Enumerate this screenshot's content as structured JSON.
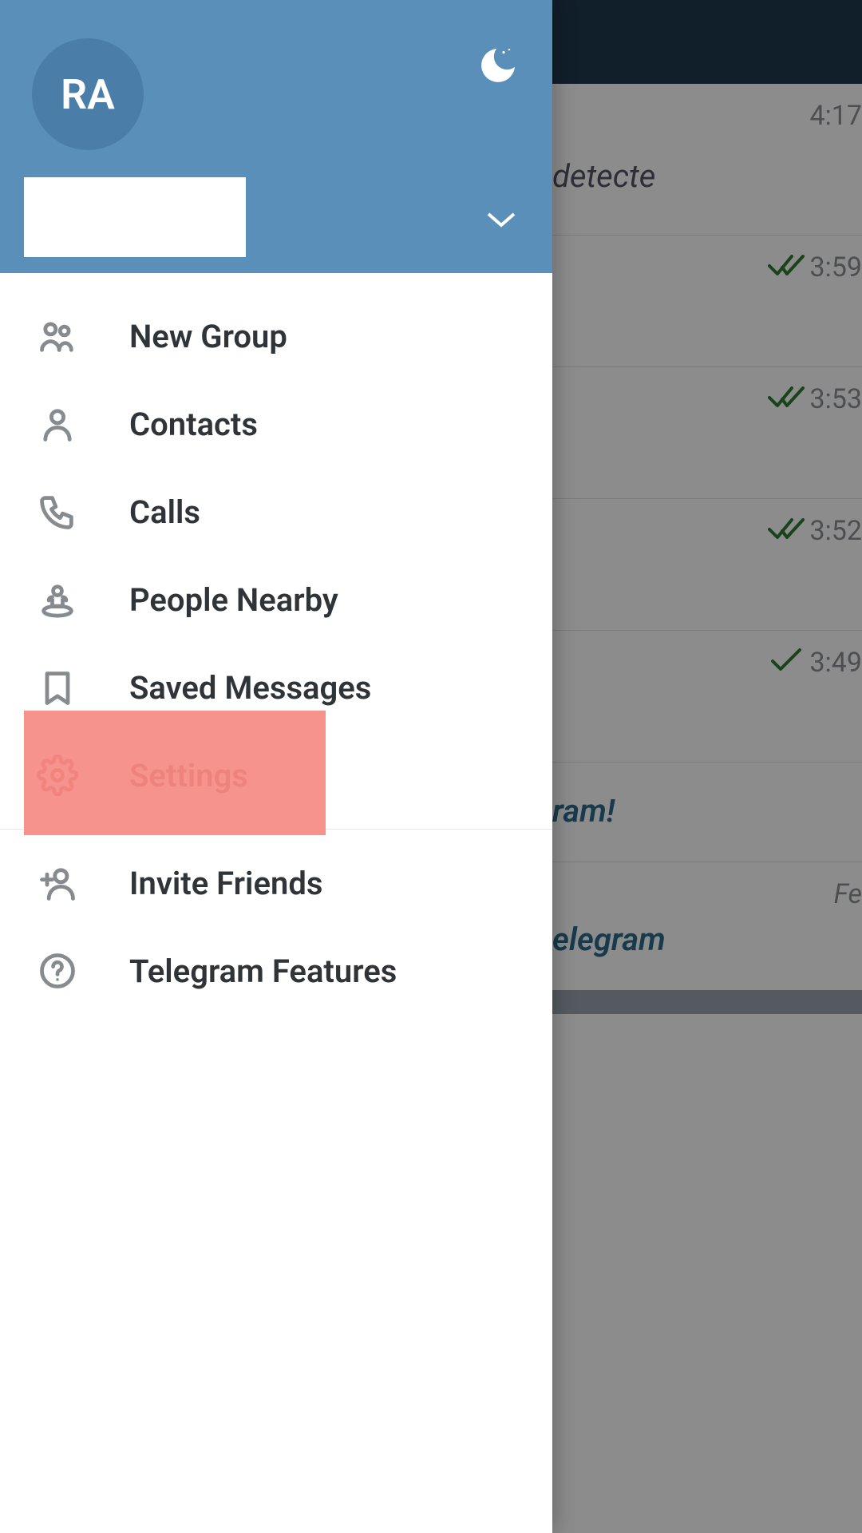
{
  "header": {
    "avatar_initials": "RA"
  },
  "menu": {
    "new_group": "New Group",
    "contacts": "Contacts",
    "calls": "Calls",
    "people_nearby": "People Nearby",
    "saved_messages": "Saved Messages",
    "settings": "Settings",
    "invite_friends": "Invite Friends",
    "telegram_features": "Telegram Features"
  },
  "chats": {
    "row0": {
      "time": "4:17",
      "snippet": "detecte"
    },
    "row1": {
      "time": "3:59"
    },
    "row2": {
      "time": "3:53"
    },
    "row3": {
      "time": "3:52"
    },
    "row4": {
      "time": "3:49"
    },
    "row5": {
      "snippet": "ram!"
    },
    "row6": {
      "date": "Fe",
      "snippet": "elegram"
    }
  }
}
